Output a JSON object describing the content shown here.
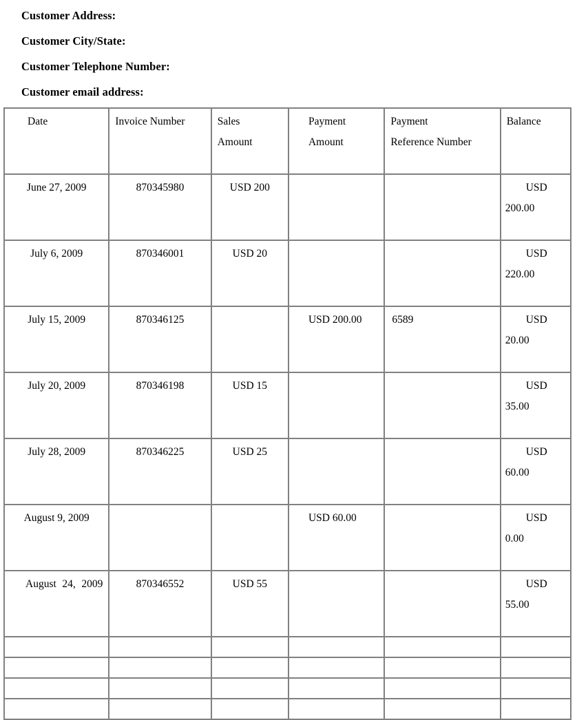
{
  "document": {
    "headings": [
      "Customer Address:",
      "Customer City/State:",
      "Customer Telephone Number:",
      "Customer email address:"
    ]
  },
  "table": {
    "columns": [
      {
        "key": "date",
        "label_line1": "Date",
        "label_line2": ""
      },
      {
        "key": "invoice",
        "label_line1": "Invoice Number",
        "label_line2": ""
      },
      {
        "key": "sales",
        "label_line1": "Sales",
        "label_line2": "Amount"
      },
      {
        "key": "payment_amount",
        "label_line1": "Payment",
        "label_line2": "Amount"
      },
      {
        "key": "payment_reference",
        "label_line1": "Payment",
        "label_line2": "Reference Number"
      },
      {
        "key": "balance",
        "label_line1": "Balance",
        "label_line2": ""
      }
    ],
    "rows": [
      {
        "date": "June 27, 2009",
        "invoice": "870345980",
        "sales": "USD 200",
        "payment_amount": "",
        "payment_reference": "",
        "balance": "USD 200.00"
      },
      {
        "date": "July 6, 2009",
        "invoice": "870346001",
        "sales": "USD 20",
        "payment_amount": "",
        "payment_reference": "",
        "balance": "USD 220.00"
      },
      {
        "date": "July 15, 2009",
        "invoice": "870346125",
        "sales": "",
        "payment_amount": "USD 200.00",
        "payment_reference": "6589",
        "balance": "USD 20.00"
      },
      {
        "date": "July 20, 2009",
        "invoice": "870346198",
        "sales": "USD 15",
        "payment_amount": "",
        "payment_reference": "",
        "balance": "USD 35.00"
      },
      {
        "date": "July 28, 2009",
        "invoice": "870346225",
        "sales": "USD 25",
        "payment_amount": "",
        "payment_reference": "",
        "balance": "USD 60.00"
      },
      {
        "date": "August 9, 2009",
        "invoice": "",
        "sales": "",
        "payment_amount": "USD 60.00",
        "payment_reference": "",
        "balance": "USD 0.00"
      },
      {
        "date": "August 24, 2009",
        "invoice": "870346552",
        "sales": "USD 55",
        "payment_amount": "",
        "payment_reference": "",
        "balance": "USD 55.00"
      }
    ],
    "blank_row_count": 4,
    "border_color": "#808080"
  }
}
